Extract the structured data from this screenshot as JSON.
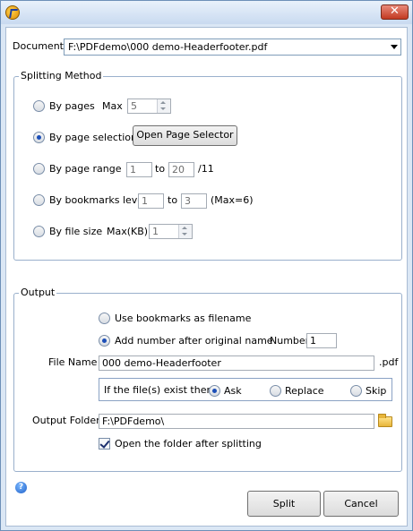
{
  "window": {
    "close_glyph": "✕",
    "app_icon": "app-icon"
  },
  "document": {
    "label": "Document",
    "value": "F:\\PDFdemo\\000 demo-Headerfooter.pdf"
  },
  "splitting": {
    "legend": "Splitting Method",
    "by_pages": {
      "label": "By pages",
      "max_label": "Max",
      "max_value": "5",
      "selected": false
    },
    "by_page_selection": {
      "label": "By page selection",
      "button": "Open Page Selector",
      "selected": true
    },
    "by_page_range": {
      "label": "By page range",
      "from": "1",
      "to_label": "to",
      "to": "20",
      "total": "/11",
      "selected": false
    },
    "by_bookmarks_level": {
      "label": "By bookmarks level",
      "from": "1",
      "to_label": "to",
      "to": "3",
      "max_note": "(Max=6)",
      "selected": false
    },
    "by_file_size": {
      "label": "By file size",
      "max_label": "Max(KB)",
      "value": "1",
      "selected": false
    }
  },
  "output": {
    "legend": "Output",
    "use_bookmarks": {
      "label": "Use bookmarks as filename",
      "selected": false
    },
    "add_number": {
      "label": "Add number after original name",
      "selected": true,
      "number_label": "Number",
      "number_value": "1"
    },
    "file_name": {
      "label": "File Name",
      "value": "000 demo-Headerfooter",
      "ext": ".pdf"
    },
    "exist": {
      "label": "If the file(s) exist then",
      "ask": "Ask",
      "replace": "Replace",
      "skip": "Skip",
      "selected": "Ask"
    },
    "folder": {
      "label": "Output Folder",
      "value": "F:\\PDFdemo\\"
    },
    "open_after": {
      "label": "Open the folder after splitting",
      "checked": true
    }
  },
  "buttons": {
    "split": "Split",
    "cancel": "Cancel"
  },
  "help_glyph": "?"
}
